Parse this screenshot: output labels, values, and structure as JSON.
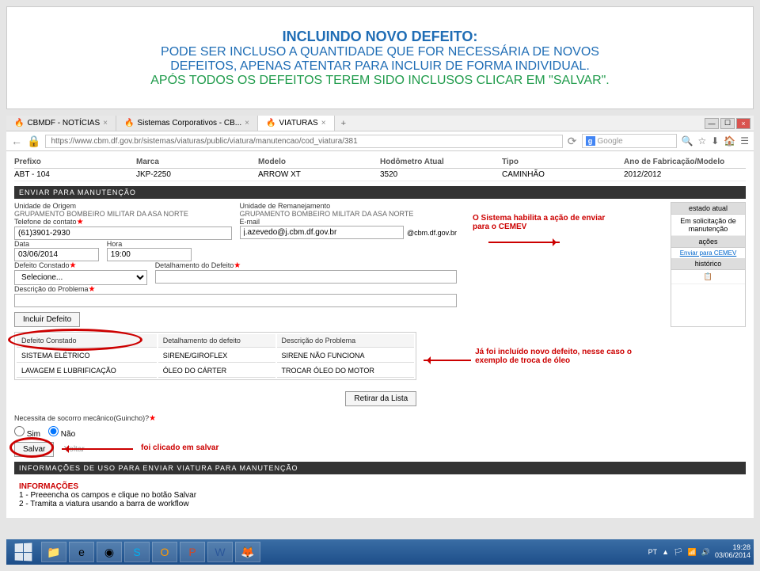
{
  "slide": {
    "line1": "INCLUINDO NOVO DEFEITO:",
    "line2": "PODE SER INCLUSO A QUANTIDADE QUE FOR NECESSÁRIA DE NOVOS",
    "line3": "DEFEITOS, APENAS ATENTAR PARA INCLUIR DE FORMA INDIVIDUAL.",
    "line4": "APÓS TODOS OS DEFEITOS TEREM SIDO INCLUSOS CLICAR EM \"SALVAR\"."
  },
  "tabs": {
    "t1": "CBMDF - NOTÍCIAS",
    "t2": "Sistemas Corporativos - CB...",
    "t3": "VIATURAS"
  },
  "url": "https://www.cbm.df.gov.br/sistemas/viaturas/public/viatura/manutencao/cod_viatura/381",
  "search": {
    "placeholder": "Google"
  },
  "vehicle": {
    "headers": {
      "prefixo": "Prefixo",
      "marca": "Marca",
      "modelo": "Modelo",
      "hodometro": "Hodômetro Atual",
      "tipo": "Tipo",
      "ano": "Ano de Fabricação/Modelo"
    },
    "data": {
      "prefixo": "ABT - 104",
      "marca": "JKP-2250",
      "modelo": "ARROW XT",
      "hodometro": "3520",
      "tipo": "CAMINHÃO",
      "ano": "2012/2012"
    }
  },
  "section1": "ENVIAR PARA MANUTENÇÃO",
  "form": {
    "origem_label": "Unidade de Origem",
    "origem_value": "GRUPAMENTO BOMBEIRO MILITAR DA ASA NORTE",
    "reman_label": "Unidade de Remanejamento",
    "reman_value": "GRUPAMENTO BOMBEIRO MILITAR DA ASA NORTE",
    "tel_label": "Telefone de contato",
    "tel_value": "(61)3901-2930",
    "email_label": "E-mail",
    "email_value": "j.azevedo@j.cbm.df.gov.br",
    "email_suffix": "@cbm.df.gov.br",
    "data_label": "Data",
    "data_value": "03/06/2014",
    "hora_label": "Hora",
    "hora_value": "19:00",
    "defeito_label": "Defeito Constado",
    "defeito_select": "Selecione...",
    "detalha_label": "Detalhamento do Defeito",
    "desc_label": "Descrição do Problema",
    "incluir_btn": "Incluir Defeito"
  },
  "sidepanel": {
    "h1": "estado atual",
    "s1": "Em solicitação de manutenção",
    "h2": "ações",
    "link": "Enviar para CEMEV",
    "h3": "histórico"
  },
  "annotation1a": "O Sistema habilita a ação de enviar",
  "annotation1b": "para o CEMEV",
  "defect_table": {
    "h1": "Defeito Constado",
    "h2": "Detalhamento do defeito",
    "h3": "Descrição do Problema",
    "rows": [
      {
        "c1": "SISTEMA ELÉTRICO",
        "c2": "SIRENE/GIROFLEX",
        "c3": "SIRENE NÃO FUNCIONA"
      },
      {
        "c1": "LAVAGEM E LUBRIFICAÇÃO",
        "c2": "ÓLEO DO CÁRTER",
        "c3": "TROCAR ÓLEO DO MOTOR"
      }
    ]
  },
  "annotation2a": "Já foi incluído novo defeito, nesse caso o",
  "annotation2b": "exemplo de troca de óleo",
  "retirar_btn": "Retirar da Lista",
  "socorro": {
    "label": "Necessita de socorro mecânico(Guincho)?",
    "sim": "Sim",
    "nao": "Não"
  },
  "salvar_btn": "Salvar",
  "voltar_btn": "Voltar",
  "annotation3": "foi clicado em salvar",
  "section2": "INFORMAÇÕES DE USO PARA ENVIAR VIATURA PARA MANUTENÇÃO",
  "info": {
    "title": "INFORMAÇÕES",
    "l1": "1 - Preeencha os campos e clique no botão Salvar",
    "l2": "2 - Tramita a viatura usando a barra de workflow"
  },
  "tray": {
    "lang": "PT",
    "time": "19:28",
    "date": "03/06/2014"
  }
}
